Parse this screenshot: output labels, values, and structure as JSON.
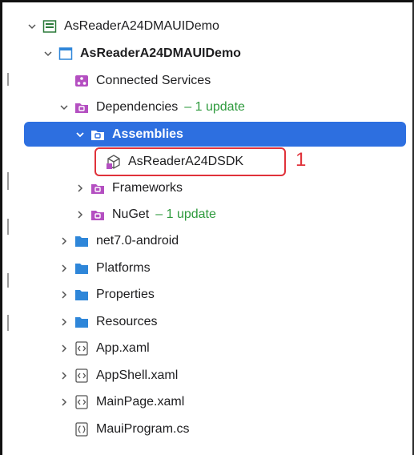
{
  "solution": {
    "label": "AsReaderA24DMAUIDemo"
  },
  "project": {
    "label": "AsReaderA24DMAUIDemo"
  },
  "items": {
    "connected_services": "Connected Services",
    "dependencies": "Dependencies",
    "dependencies_update": "– 1 update",
    "assemblies": "Assemblies",
    "sdk": "AsReaderA24DSDK",
    "frameworks": "Frameworks",
    "nuget": "NuGet",
    "nuget_update": "– 1 update",
    "net7": "net7.0-android",
    "platforms": "Platforms",
    "properties": "Properties",
    "resources": "Resources",
    "app_xaml": "App.xaml",
    "appshell_xaml": "AppShell.xaml",
    "mainpage_xaml": "MainPage.xaml",
    "mauiprogram_cs": "MauiProgram.cs"
  },
  "annotation": {
    "number": "1"
  },
  "colors": {
    "selection": "#2d6fe0",
    "reference_folder": "#b44fc1",
    "folder": "#2e86d9",
    "update_text": "#2e9a3d",
    "annotation": "#e0323a"
  }
}
